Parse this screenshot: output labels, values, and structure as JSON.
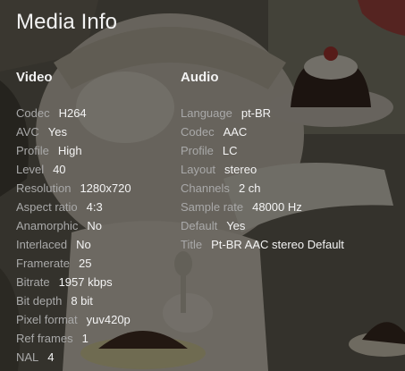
{
  "dialog": {
    "title": "Media Info"
  },
  "video": {
    "heading": "Video",
    "rows": [
      {
        "key": "Codec",
        "value": "H264"
      },
      {
        "key": "AVC",
        "value": "Yes"
      },
      {
        "key": "Profile",
        "value": "High"
      },
      {
        "key": "Level",
        "value": "40"
      },
      {
        "key": "Resolution",
        "value": "1280x720"
      },
      {
        "key": "Aspect ratio",
        "value": "4:3"
      },
      {
        "key": "Anamorphic",
        "value": "No"
      },
      {
        "key": "Interlaced",
        "value": "No"
      },
      {
        "key": "Framerate",
        "value": "25"
      },
      {
        "key": "Bitrate",
        "value": "1957 kbps"
      },
      {
        "key": "Bit depth",
        "value": "8 bit"
      },
      {
        "key": "Pixel format",
        "value": "yuv420p"
      },
      {
        "key": "Ref frames",
        "value": "1"
      },
      {
        "key": "NAL",
        "value": "4"
      }
    ]
  },
  "audio": {
    "heading": "Audio",
    "rows": [
      {
        "key": "Language",
        "value": "pt-BR"
      },
      {
        "key": "Codec",
        "value": "AAC"
      },
      {
        "key": "Profile",
        "value": "LC"
      },
      {
        "key": "Layout",
        "value": "stereo"
      },
      {
        "key": "Channels",
        "value": "2 ch"
      },
      {
        "key": "Sample rate",
        "value": "48000 Hz"
      },
      {
        "key": "Default",
        "value": "Yes"
      },
      {
        "key": "Title",
        "value": "Pt-BR AAC stereo Default"
      }
    ]
  },
  "colors": {
    "overlay": "#000000",
    "key_text": "#a9a9a9",
    "value_text": "#f4f4f4"
  }
}
